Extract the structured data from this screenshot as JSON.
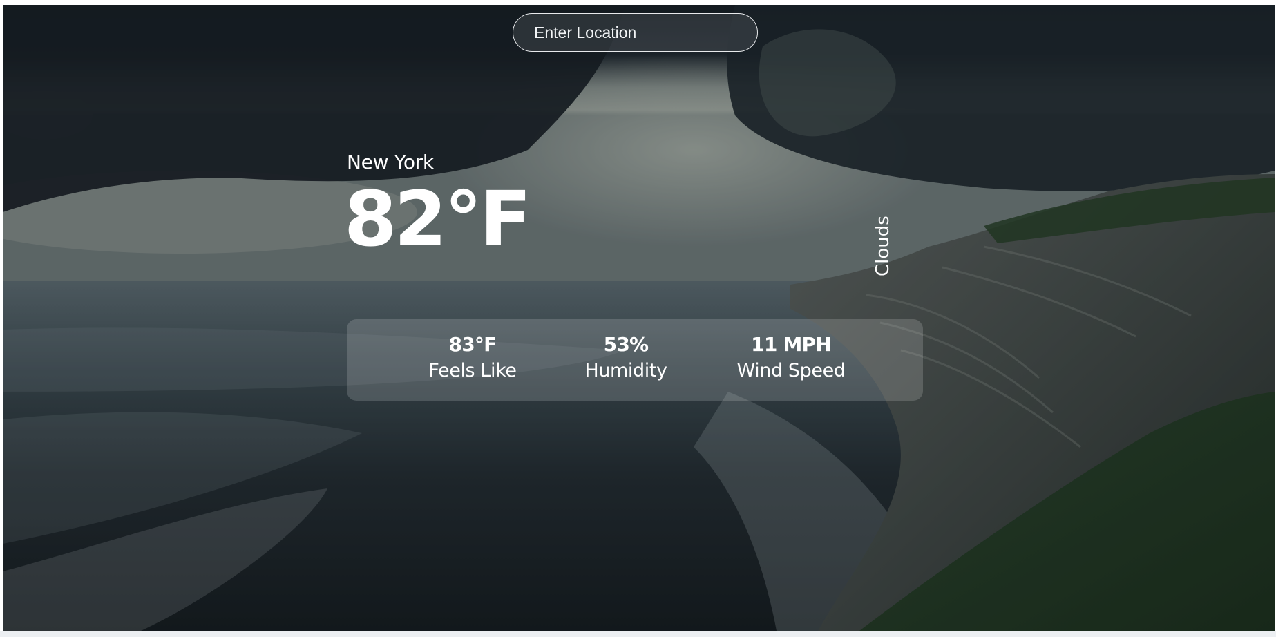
{
  "search": {
    "placeholder": "Enter Location"
  },
  "weather": {
    "location": "New York",
    "temperature": "82°F",
    "description": "Clouds"
  },
  "stats": {
    "feels_like": {
      "value": "83°F",
      "label": "Feels Like"
    },
    "humidity": {
      "value": "53%",
      "label": "Humidity"
    },
    "wind_speed": {
      "value": "11 MPH",
      "label": "Wind Speed"
    }
  },
  "colors": {
    "text": "#ffffff",
    "sky_dark": "#1f2830",
    "sea": "#3c5058",
    "grass": "#2a4a2c"
  }
}
